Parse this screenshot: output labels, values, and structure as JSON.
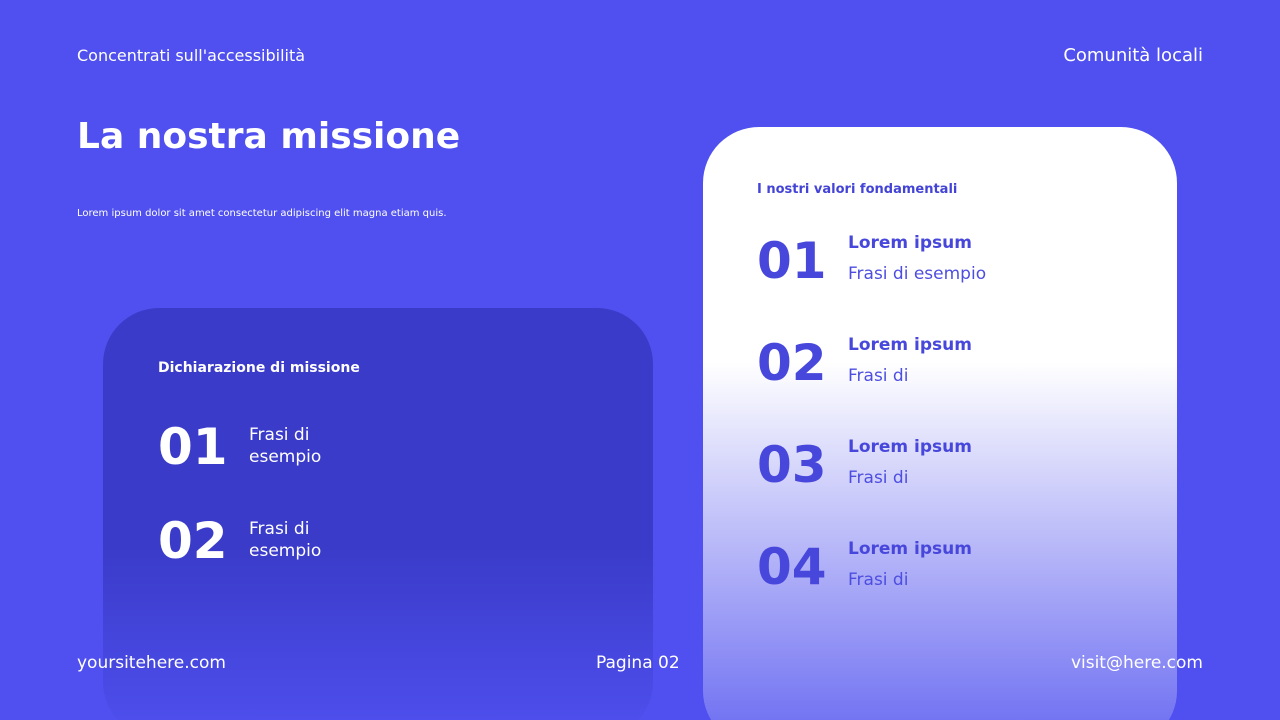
{
  "header": {
    "left_text": "Concentrati sull'accessibilità",
    "right_text": "Comunità locali"
  },
  "main": {
    "title": "La nostra missione",
    "lead": "Lorem ipsum dolor sit amet consectetur adipiscing elit magna etiam quis."
  },
  "mission_card": {
    "heading": "Dichiarazione di missione",
    "items": [
      {
        "number": "01",
        "text": "Frasi di esempio"
      },
      {
        "number": "02",
        "text": "Frasi di esempio"
      }
    ]
  },
  "values_card": {
    "heading": "I nostri valori fondamentali",
    "items": [
      {
        "number": "01",
        "label": "Lorem ipsum",
        "text": "Frasi di esempio"
      },
      {
        "number": "02",
        "label": "Lorem ipsum",
        "text": "Frasi di"
      },
      {
        "number": "03",
        "label": "Lorem ipsum",
        "text": "Frasi di"
      },
      {
        "number": "04",
        "label": "Lorem ipsum",
        "text": "Frasi di"
      }
    ]
  },
  "footer": {
    "website": "yoursitehere.com",
    "page": "Pagina 02",
    "email": "visit@here.com"
  },
  "colors": {
    "background": "#4f50ef",
    "card_dark": "#3a3bc8",
    "accent_text": "#4747dc"
  }
}
